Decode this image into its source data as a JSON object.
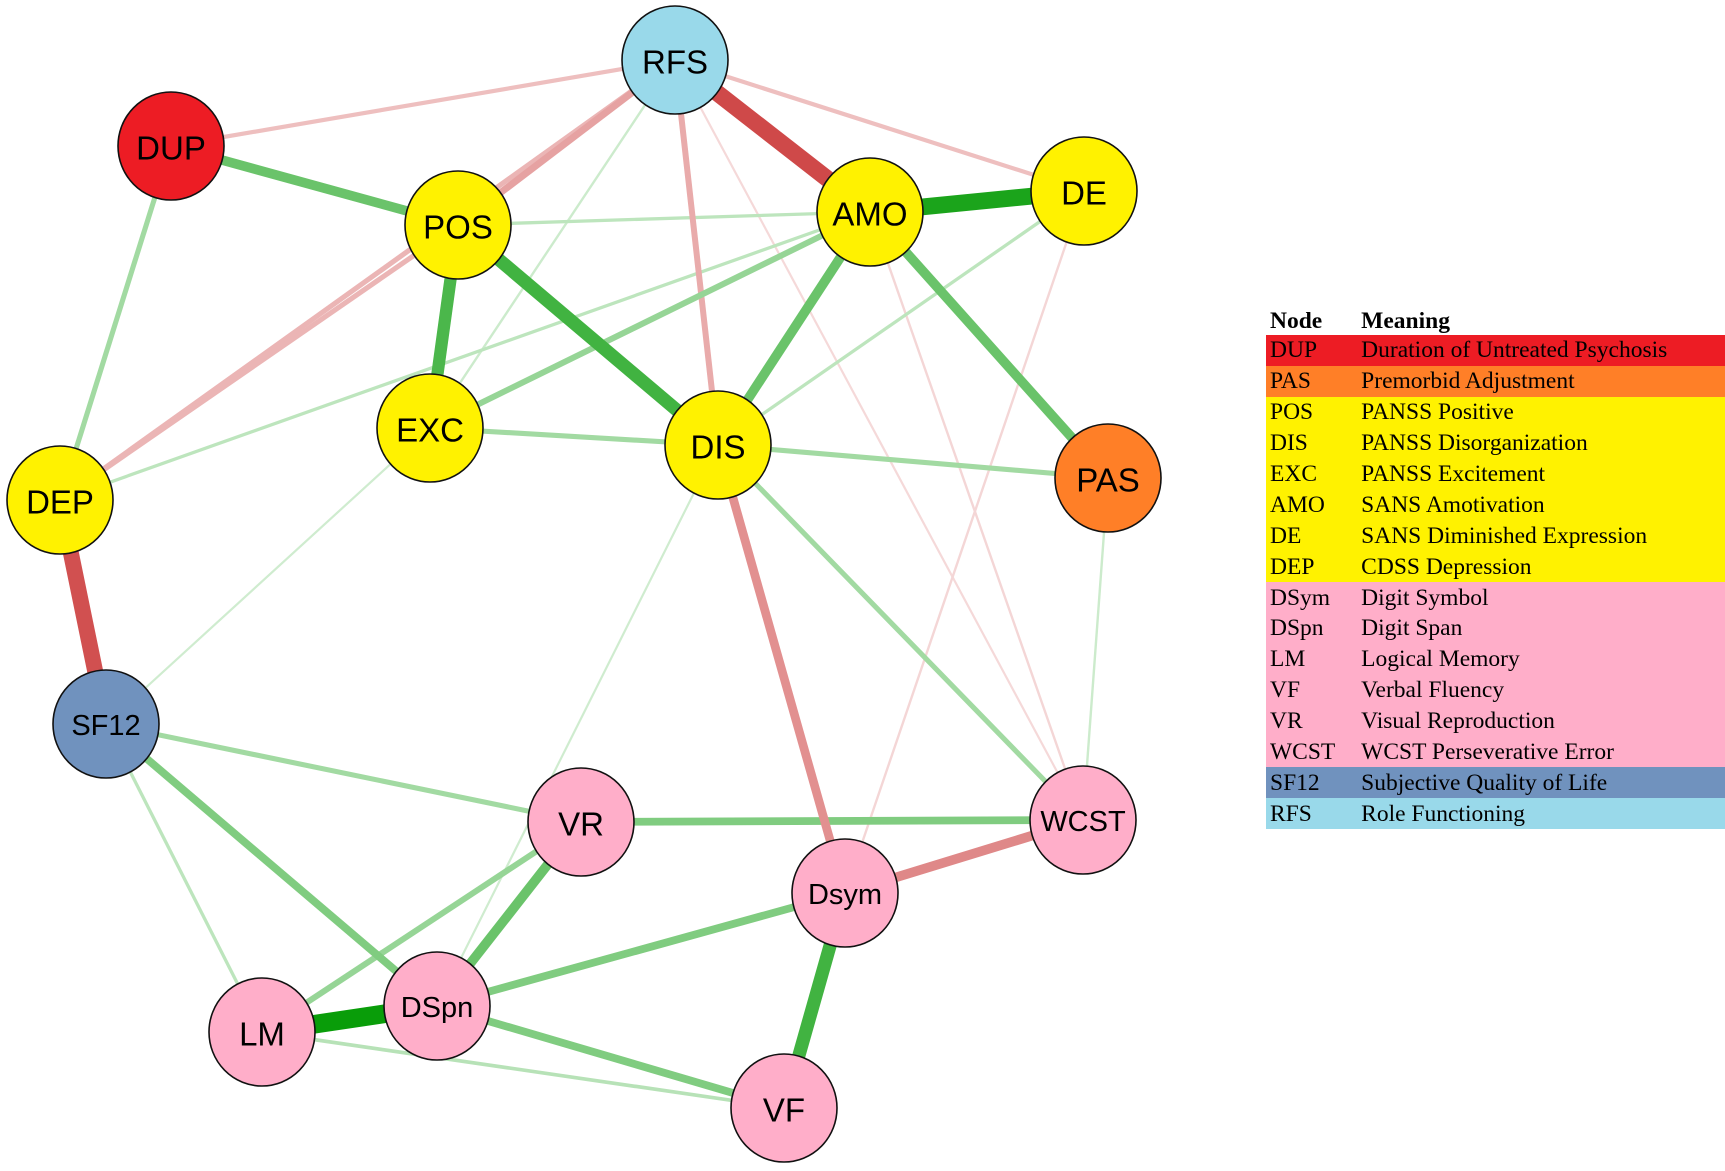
{
  "diagram": {
    "type": "network",
    "nodes": [
      {
        "id": "RFS",
        "label": "RFS",
        "group": "role"
      },
      {
        "id": "DUP",
        "label": "DUP",
        "group": "dup"
      },
      {
        "id": "POS",
        "label": "POS",
        "group": "symptom"
      },
      {
        "id": "AMO",
        "label": "AMO",
        "group": "symptom"
      },
      {
        "id": "DE",
        "label": "DE",
        "group": "symptom"
      },
      {
        "id": "EXC",
        "label": "EXC",
        "group": "symptom"
      },
      {
        "id": "DIS",
        "label": "DIS",
        "group": "symptom"
      },
      {
        "id": "DEP",
        "label": "DEP",
        "group": "symptom"
      },
      {
        "id": "PAS",
        "label": "PAS",
        "group": "pas"
      },
      {
        "id": "SF12",
        "label": "SF12",
        "group": "qol"
      },
      {
        "id": "VR",
        "label": "VR",
        "group": "cognition"
      },
      {
        "id": "WCST",
        "label": "WCST",
        "group": "cognition"
      },
      {
        "id": "Dsym",
        "label": "Dsym",
        "group": "cognition"
      },
      {
        "id": "DSpn",
        "label": "DSpn",
        "group": "cognition"
      },
      {
        "id": "LM",
        "label": "LM",
        "group": "cognition"
      },
      {
        "id": "VF",
        "label": "VF",
        "group": "cognition"
      }
    ],
    "group_colors": {
      "dup": "#ED1C24",
      "pas": "#FF7F27",
      "symptom": "#FFF200",
      "cognition": "#FFAEC9",
      "qol": "#7092BE",
      "role": "#99D9EA"
    },
    "edge_colors": {
      "positive": "#009900",
      "negative": "#C62828"
    },
    "edges": [
      {
        "from": "RFS",
        "to": "AMO",
        "sign": "negative",
        "strength": 0.85
      },
      {
        "from": "RFS",
        "to": "DUP",
        "sign": "negative",
        "strength": 0.15
      },
      {
        "from": "RFS",
        "to": "POS",
        "sign": "negative",
        "strength": 0.3
      },
      {
        "from": "RFS",
        "to": "DEP",
        "sign": "negative",
        "strength": 0.2
      },
      {
        "from": "RFS",
        "to": "DIS",
        "sign": "negative",
        "strength": 0.25
      },
      {
        "from": "RFS",
        "to": "DE",
        "sign": "negative",
        "strength": 0.15
      },
      {
        "from": "RFS",
        "to": "EXC",
        "sign": "positive",
        "strength": 0.05
      },
      {
        "from": "RFS",
        "to": "WCST",
        "sign": "negative",
        "strength": 0.04
      },
      {
        "from": "DUP",
        "to": "POS",
        "sign": "positive",
        "strength": 0.45
      },
      {
        "from": "DUP",
        "to": "DEP",
        "sign": "positive",
        "strength": 0.2
      },
      {
        "from": "POS",
        "to": "EXC",
        "sign": "positive",
        "strength": 0.6
      },
      {
        "from": "POS",
        "to": "DIS",
        "sign": "positive",
        "strength": 0.65
      },
      {
        "from": "POS",
        "to": "AMO",
        "sign": "positive",
        "strength": 0.1
      },
      {
        "from": "POS",
        "to": "DEP",
        "sign": "negative",
        "strength": 0.2
      },
      {
        "from": "AMO",
        "to": "DE",
        "sign": "positive",
        "strength": 0.85
      },
      {
        "from": "AMO",
        "to": "DIS",
        "sign": "positive",
        "strength": 0.45
      },
      {
        "from": "AMO",
        "to": "PAS",
        "sign": "positive",
        "strength": 0.45
      },
      {
        "from": "AMO",
        "to": "EXC",
        "sign": "positive",
        "strength": 0.25
      },
      {
        "from": "AMO",
        "to": "DEP",
        "sign": "positive",
        "strength": 0.1
      },
      {
        "from": "AMO",
        "to": "WCST",
        "sign": "negative",
        "strength": 0.05
      },
      {
        "from": "DE",
        "to": "DIS",
        "sign": "positive",
        "strength": 0.1
      },
      {
        "from": "DE",
        "to": "Dsym",
        "sign": "negative",
        "strength": 0.05
      },
      {
        "from": "EXC",
        "to": "DIS",
        "sign": "positive",
        "strength": 0.2
      },
      {
        "from": "EXC",
        "to": "SF12",
        "sign": "positive",
        "strength": 0.04
      },
      {
        "from": "DIS",
        "to": "PAS",
        "sign": "positive",
        "strength": 0.2
      },
      {
        "from": "DIS",
        "to": "Dsym",
        "sign": "negative",
        "strength": 0.4
      },
      {
        "from": "DIS",
        "to": "WCST",
        "sign": "positive",
        "strength": 0.2
      },
      {
        "from": "DIS",
        "to": "DSpn",
        "sign": "positive",
        "strength": 0.04
      },
      {
        "from": "PAS",
        "to": "WCST",
        "sign": "positive",
        "strength": 0.05
      },
      {
        "from": "DEP",
        "to": "SF12",
        "sign": "negative",
        "strength": 0.8
      },
      {
        "from": "SF12",
        "to": "VR",
        "sign": "positive",
        "strength": 0.2
      },
      {
        "from": "SF12",
        "to": "DSpn",
        "sign": "positive",
        "strength": 0.35
      },
      {
        "from": "SF12",
        "to": "LM",
        "sign": "positive",
        "strength": 0.1
      },
      {
        "from": "VR",
        "to": "WCST",
        "sign": "positive",
        "strength": 0.35
      },
      {
        "from": "VR",
        "to": "DSpn",
        "sign": "positive",
        "strength": 0.45
      },
      {
        "from": "VR",
        "to": "LM",
        "sign": "positive",
        "strength": 0.25
      },
      {
        "from": "WCST",
        "to": "Dsym",
        "sign": "negative",
        "strength": 0.45
      },
      {
        "from": "Dsym",
        "to": "DSpn",
        "sign": "positive",
        "strength": 0.35
      },
      {
        "from": "Dsym",
        "to": "VF",
        "sign": "positive",
        "strength": 0.65
      },
      {
        "from": "DSpn",
        "to": "LM",
        "sign": "positive",
        "strength": 0.95
      },
      {
        "from": "DSpn",
        "to": "VF",
        "sign": "positive",
        "strength": 0.35
      },
      {
        "from": "LM",
        "to": "VF",
        "sign": "positive",
        "strength": 0.12
      }
    ]
  },
  "legend": {
    "header": {
      "node": "Node",
      "meaning": "Meaning"
    },
    "rows": [
      {
        "code": "DUP",
        "meaning": "Duration of Untreated Psychosis",
        "group": "dup"
      },
      {
        "code": "PAS",
        "meaning": "Premorbid Adjustment",
        "group": "pas"
      },
      {
        "code": "POS",
        "meaning": "PANSS Positive",
        "group": "symptom"
      },
      {
        "code": "DIS",
        "meaning": "PANSS Disorganization",
        "group": "symptom"
      },
      {
        "code": "EXC",
        "meaning": "PANSS Excitement",
        "group": "symptom"
      },
      {
        "code": "AMO",
        "meaning": "SANS Amotivation",
        "group": "symptom"
      },
      {
        "code": "DE",
        "meaning": "SANS Diminished Expression",
        "group": "symptom"
      },
      {
        "code": "DEP",
        "meaning": "CDSS Depression",
        "group": "symptom"
      },
      {
        "code": "DSym",
        "meaning": "Digit Symbol",
        "group": "cognition"
      },
      {
        "code": "DSpn",
        "meaning": "Digit Span",
        "group": "cognition"
      },
      {
        "code": "LM",
        "meaning": "Logical Memory",
        "group": "cognition"
      },
      {
        "code": "VF",
        "meaning": "Verbal Fluency",
        "group": "cognition"
      },
      {
        "code": "VR",
        "meaning": "Visual Reproduction",
        "group": "cognition"
      },
      {
        "code": "WCST",
        "meaning": "WCST Perseverative Error",
        "group": "cognition"
      },
      {
        "code": "SF12",
        "meaning": "Subjective Quality of Life",
        "group": "qol"
      },
      {
        "code": "RFS",
        "meaning": "Role Functioning",
        "group": "role"
      }
    ]
  }
}
